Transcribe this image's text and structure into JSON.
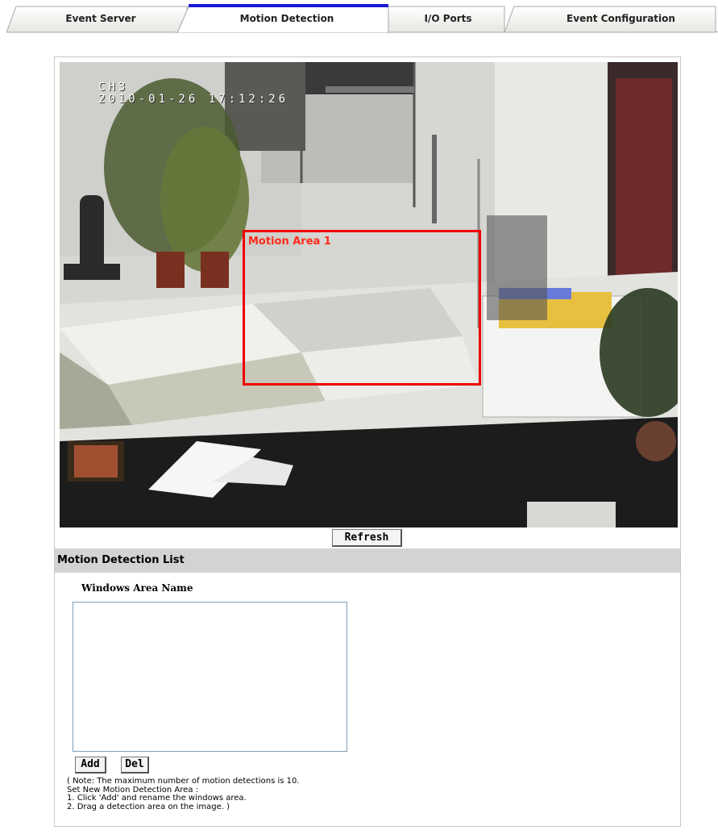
{
  "tabs": [
    {
      "label": "Event Server",
      "active": false
    },
    {
      "label": "Motion Detection",
      "active": true
    },
    {
      "label": "I/O Ports",
      "active": false
    },
    {
      "label": "Event Configuration",
      "active": false
    }
  ],
  "camera": {
    "channel": "CH3",
    "timestamp": "2010-01-26 17:12:26",
    "motion_area_label": "Motion Area 1",
    "motion_area_color": "#ee0000"
  },
  "buttons": {
    "refresh": "Refresh",
    "add": "Add",
    "del": "Del"
  },
  "list_section": {
    "title": "Motion Detection List",
    "column_label": "Windows Area Name",
    "items": []
  },
  "notes": [
    "( Note: The maximum number of motion detections is 10.",
    "Set New Motion Detection Area :",
    "1. Click 'Add' and rename the windows area.",
    "2. Drag a detection area on the image. )"
  ],
  "colors": {
    "active_tab_accent": "#1a1adc",
    "section_header_bg": "#d3d3d3"
  }
}
